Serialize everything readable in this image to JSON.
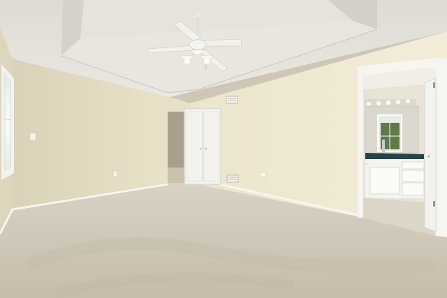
{
  "scene": {
    "subject": "empty-bedroom-with-ensuite-bathroom",
    "colors": {
      "ceiling": "#e4e1da",
      "ceiling_shadow": "#cfccc5",
      "wall_left": "#e6dfc6",
      "wall_back": "#ece6cf",
      "wall_right": "#f1ead3",
      "carpet": "#cdc5b5",
      "baseboard": "#f7f5ef",
      "door": "#f5f4f0",
      "vanity_counter": "#27424a",
      "bathroom_wall": "#e8e3d6"
    }
  }
}
